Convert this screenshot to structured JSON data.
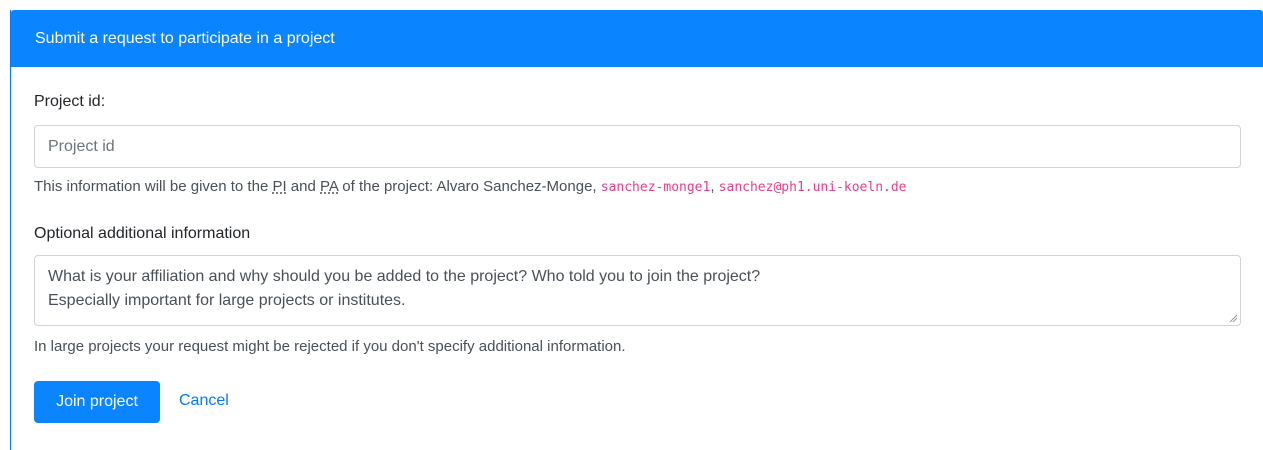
{
  "card": {
    "title": "Submit a request to participate in a project"
  },
  "project_field": {
    "label": "Project id:",
    "placeholder": "Project id",
    "value": ""
  },
  "project_help": {
    "prefix": "This information will be given to the ",
    "pi_abbr": "PI",
    "and": " and ",
    "pa_abbr": "PA",
    "middle": " of the project: Alvaro Sanchez-Monge, ",
    "username": "sanchez-monge1",
    "comma": ", ",
    "email": "sanchez@ph1.uni-koeln.de"
  },
  "optional_field": {
    "label": "Optional additional information",
    "placeholder_line1": "What is your affiliation and why should you be added to the project? Who told you to join the project?",
    "placeholder_line2": "Especially important for large projects or institutes."
  },
  "optional_help": "In large projects your request might be rejected if you don't specify additional information.",
  "actions": {
    "join_label": "Join project",
    "cancel_label": "Cancel"
  },
  "colors": {
    "primary": "#0a84ff",
    "code": "#e83e8c",
    "link": "#007bff"
  }
}
